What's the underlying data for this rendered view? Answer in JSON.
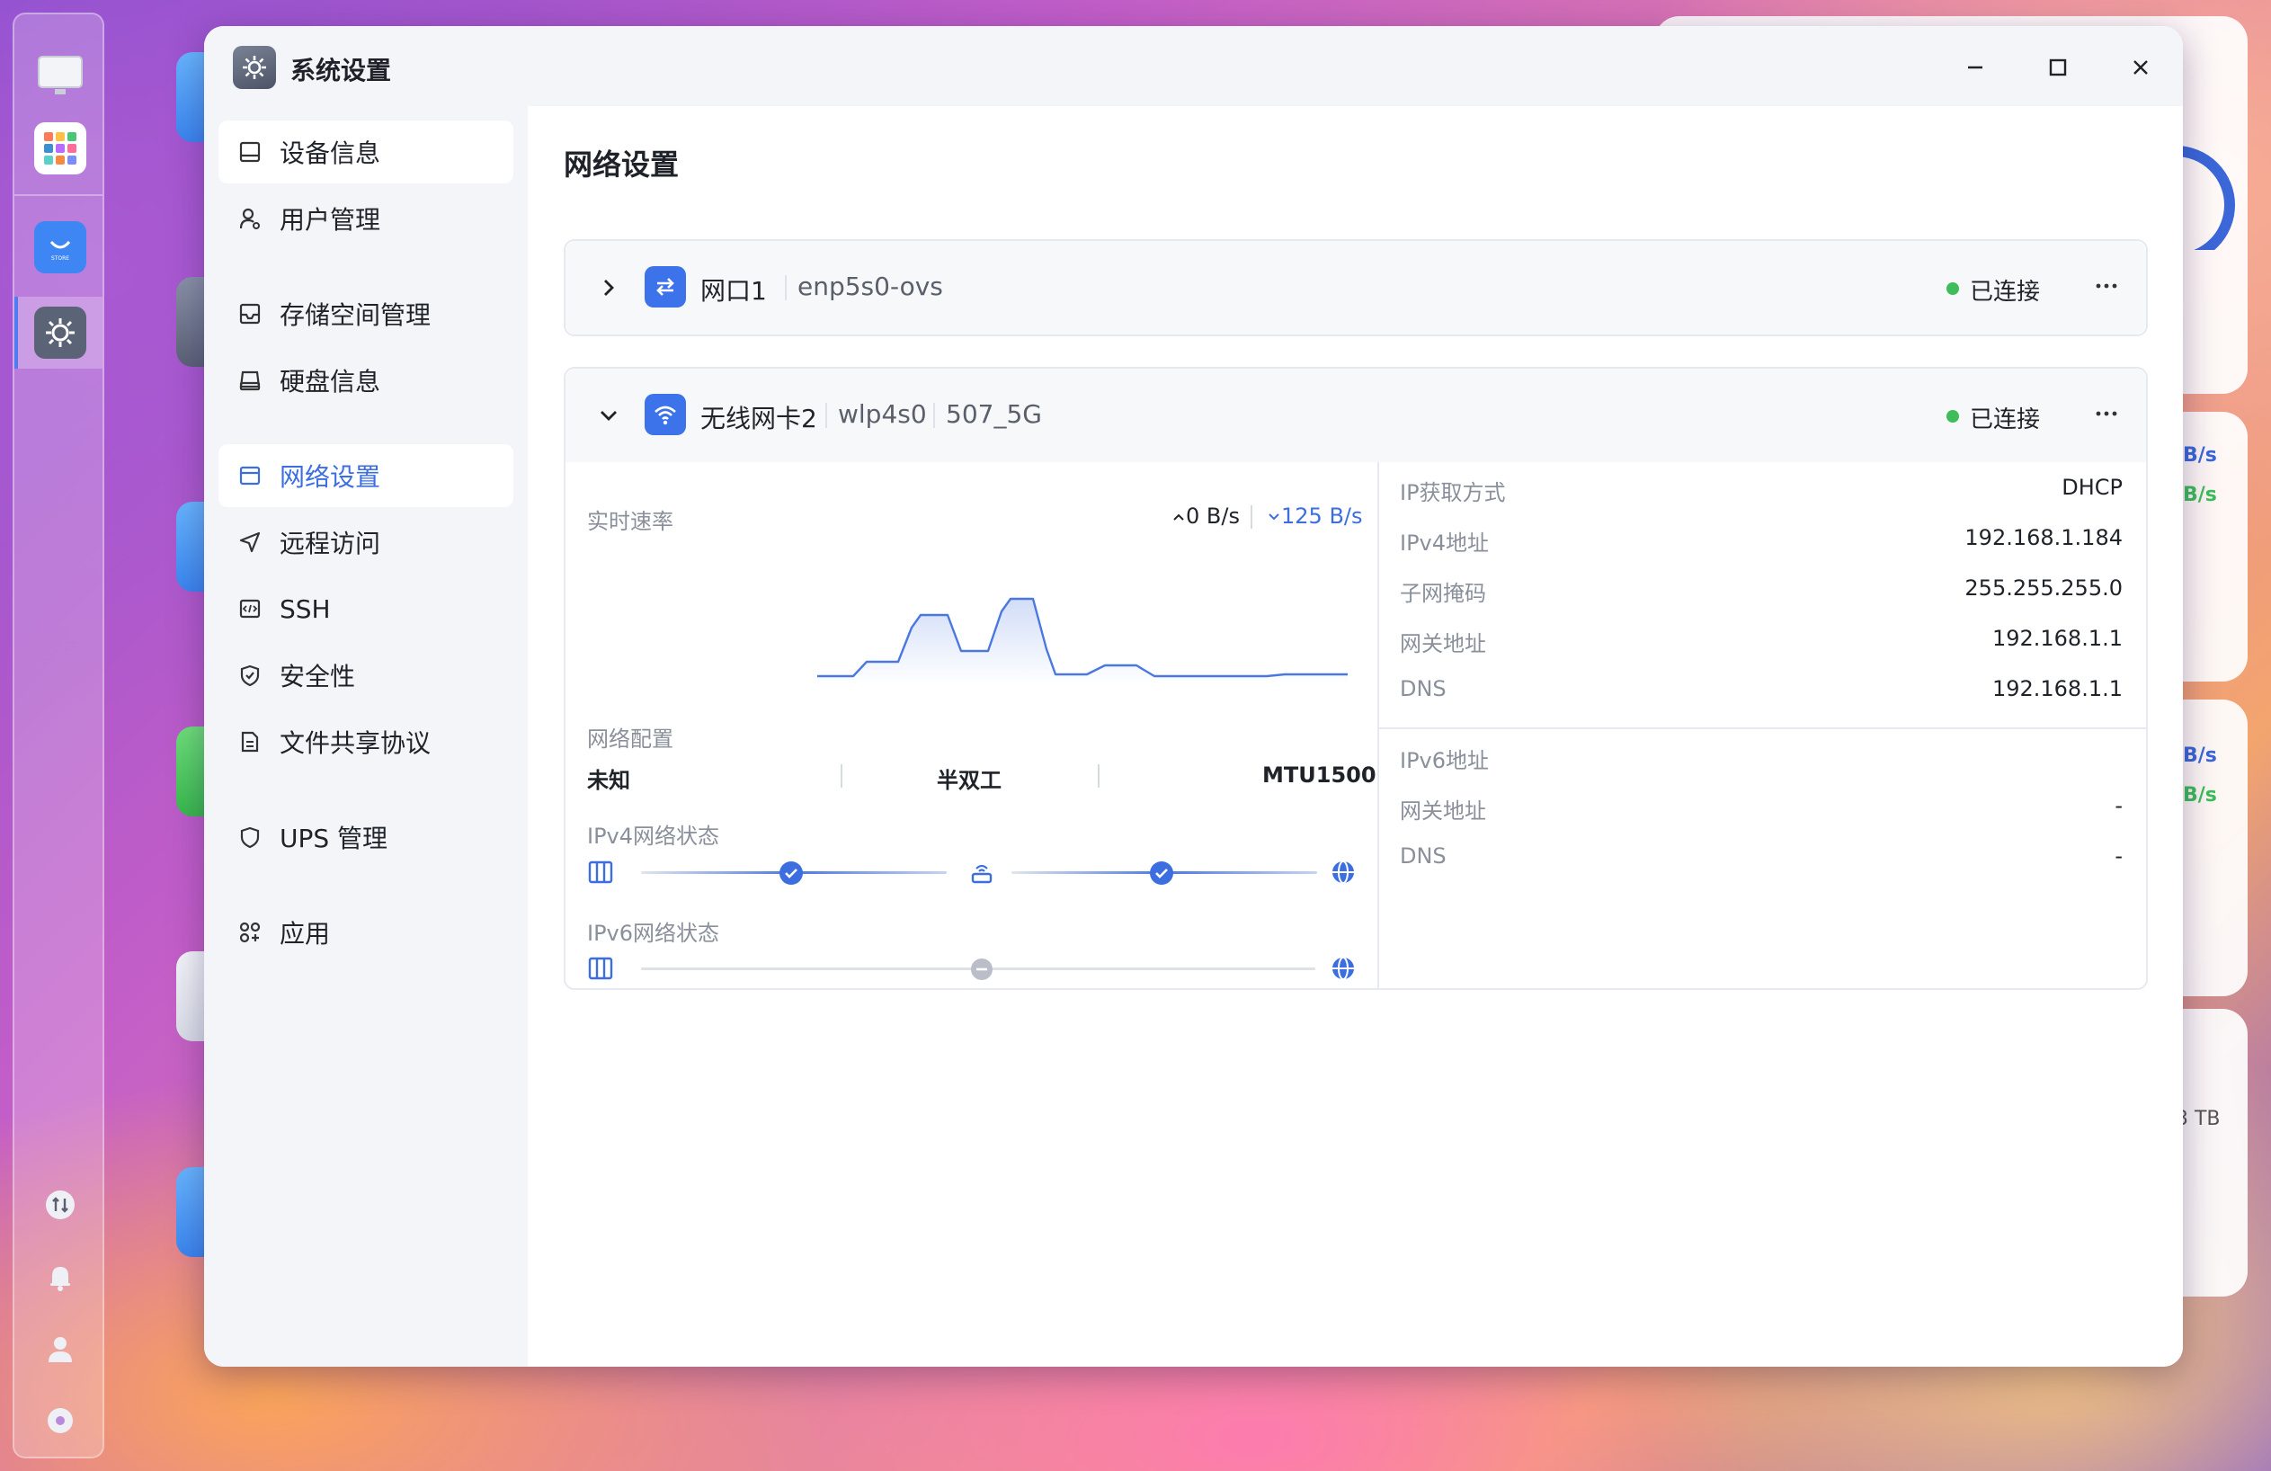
{
  "window": {
    "title": "系统设置"
  },
  "sidebar": {
    "items": [
      {
        "label": "设备信息",
        "icon": "device-icon"
      },
      {
        "label": "用户管理",
        "icon": "user-icon"
      },
      {
        "label": "存储空间管理",
        "icon": "storage-icon"
      },
      {
        "label": "硬盘信息",
        "icon": "disk-icon"
      },
      {
        "label": "网络设置",
        "icon": "network-icon"
      },
      {
        "label": "远程访问",
        "icon": "send-icon"
      },
      {
        "label": "SSH",
        "icon": "code-icon"
      },
      {
        "label": "安全性",
        "icon": "shield-check-icon"
      },
      {
        "label": "文件共享协议",
        "icon": "file-icon"
      },
      {
        "label": "UPS 管理",
        "icon": "shield-icon"
      },
      {
        "label": "应用",
        "icon": "apps-icon"
      }
    ],
    "selected": "网络设置"
  },
  "main": {
    "title": "网络设置",
    "interfaces": [
      {
        "name": "网口1",
        "device": "enp5s0-ovs",
        "status": "已连接",
        "expanded": false
      },
      {
        "name": "无线网卡2",
        "device": "wlp4s0",
        "ssid": "507_5G",
        "status": "已连接",
        "expanded": true,
        "speed": {
          "label": "实时速率",
          "up": "0 B/s",
          "down": "125 B/s"
        },
        "config": {
          "label": "网络配置",
          "speed": "未知",
          "duplex": "半双工",
          "mtu": "MTU1500"
        },
        "ipv4_status_label": "IPv4网络状态",
        "ipv6_status_label": "IPv6网络状态",
        "ipv4_info": [
          {
            "label": "IP获取方式",
            "value": "DHCP"
          },
          {
            "label": "IPv4地址",
            "value": "192.168.1.184"
          },
          {
            "label": "子网掩码",
            "value": "255.255.255.0"
          },
          {
            "label": "网关地址",
            "value": "192.168.1.1"
          },
          {
            "label": "DNS",
            "value": "192.168.1.1"
          }
        ],
        "ipv6_info": [
          {
            "label": "IPv6地址",
            "value": ""
          },
          {
            "label": "网关地址",
            "value": "-"
          },
          {
            "label": "DNS",
            "value": "-"
          }
        ]
      }
    ]
  },
  "background": {
    "widget_values": [
      "B/s",
      "B/s",
      "B/s",
      "B/s",
      "3 TB"
    ]
  },
  "colors": {
    "accent": "#3d6ee0",
    "status_ok": "#3ebd5a",
    "chart_line": "#4a78e0"
  }
}
